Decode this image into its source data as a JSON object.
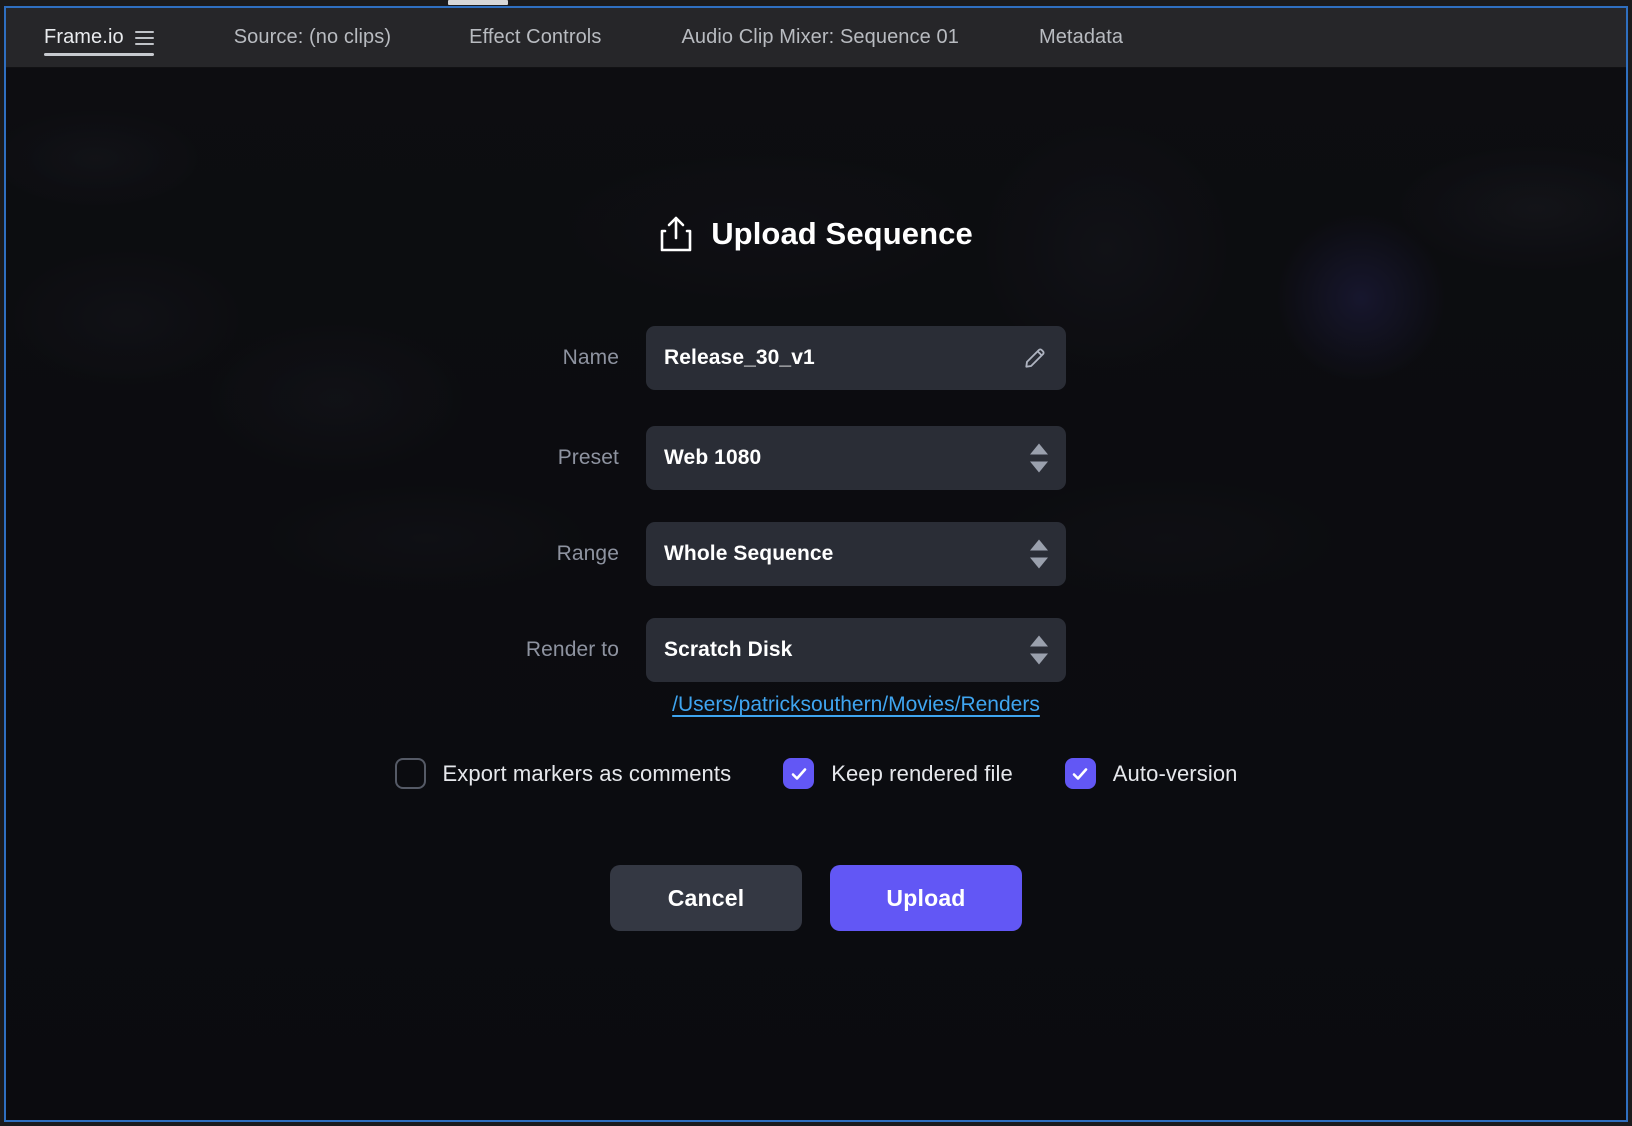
{
  "window": {
    "accent_blue": "#2f6fc0",
    "panel_bg": "#15161a"
  },
  "tabbar": {
    "tabs": [
      {
        "label": "Frame.io",
        "active": true,
        "has_menu_icon": true
      },
      {
        "label": "Source: (no clips)",
        "active": false
      },
      {
        "label": "Effect Controls",
        "active": false
      },
      {
        "label": "Audio Clip Mixer: Sequence 01",
        "active": false
      },
      {
        "label": "Metadata",
        "active": false
      }
    ],
    "menu_icon": "hamburger-menu-icon"
  },
  "dialog": {
    "title": "Upload Sequence",
    "title_icon": "upload-share-icon",
    "fields": [
      {
        "label": "Name",
        "value": "Release_30_v1",
        "control": "text-input",
        "icon": "pencil-edit-icon"
      },
      {
        "label": "Preset",
        "value": "Web 1080",
        "control": "select",
        "icon": "stepper-arrows-icon"
      },
      {
        "label": "Range",
        "value": "Whole Sequence",
        "control": "select",
        "icon": "stepper-arrows-icon"
      },
      {
        "label": "Render to",
        "value": "Scratch Disk",
        "control": "select",
        "icon": "stepper-arrows-icon"
      }
    ],
    "render_path": "/Users/patricksouthern/Movies/Renders",
    "render_path_color": "#3fa5f0",
    "checkboxes": [
      {
        "label": "Export markers as comments",
        "checked": false
      },
      {
        "label": "Keep rendered file",
        "checked": true
      },
      {
        "label": "Auto-version",
        "checked": true
      }
    ],
    "checkbox_on_color": "#6257f5",
    "buttons": {
      "cancel": "Cancel",
      "upload": "Upload",
      "upload_color": "#6257f5",
      "cancel_color": "#343843"
    }
  }
}
